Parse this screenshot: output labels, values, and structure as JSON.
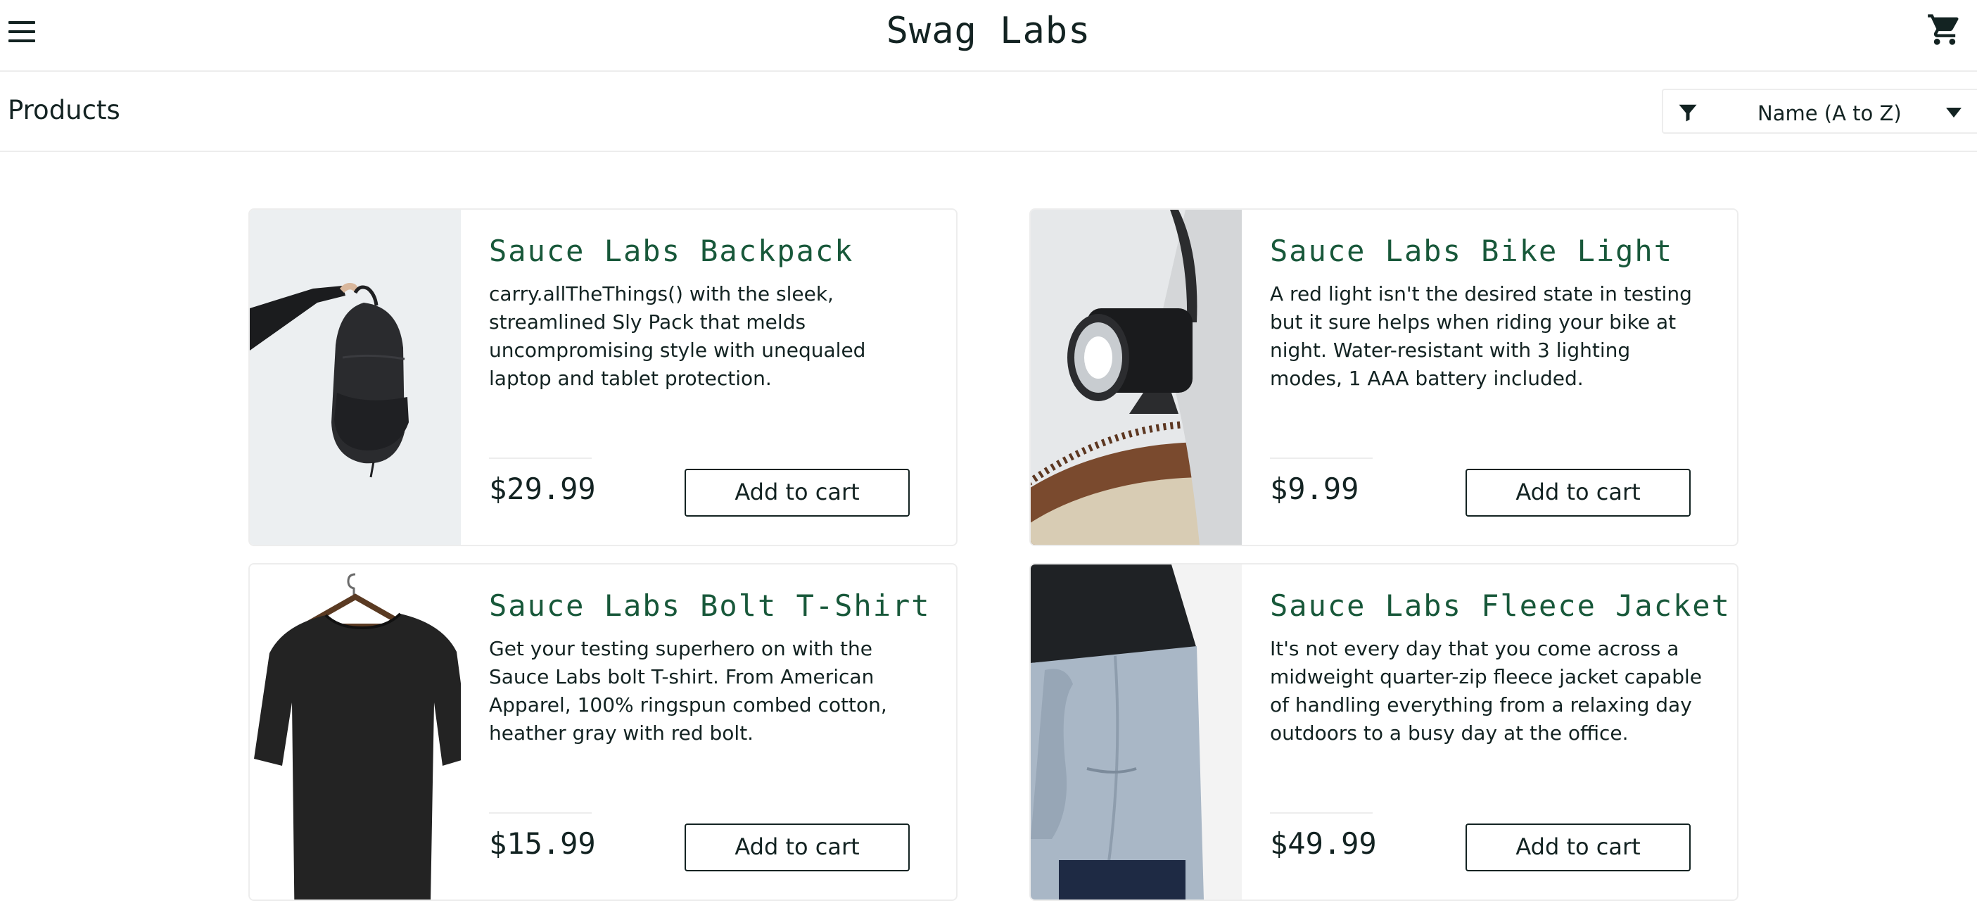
{
  "header": {
    "logo": "Swag Labs",
    "menu_icon": "hamburger-menu-icon",
    "cart_icon": "shopping-cart-icon"
  },
  "subheader": {
    "title": "Products",
    "sort_selected": "Name (A to Z)",
    "sort_icon": "filter-icon",
    "dropdown_icon": "caret-down-icon"
  },
  "colors": {
    "text": "#132322",
    "product_name": "#18583a",
    "border": "#ededed",
    "background": "#ffffff"
  },
  "products": [
    {
      "name": "Sauce Labs Backpack",
      "description": "carry.allTheThings() with the sleek, streamlined Sly Pack that melds uncompromising style with unequaled laptop and tablet protection.",
      "price": "$29.99",
      "button": "Add to cart",
      "image": "backpack-image"
    },
    {
      "name": "Sauce Labs Bike Light",
      "description": "A red light isn't the desired state in testing but it sure helps when riding your bike at night. Water-resistant with 3 lighting modes, 1 AAA battery included.",
      "price": "$9.99",
      "button": "Add to cart",
      "image": "bike-light-image"
    },
    {
      "name": "Sauce Labs Bolt T-Shirt",
      "description": "Get your testing superhero on with the Sauce Labs bolt T-shirt. From American Apparel, 100% ringspun combed cotton, heather gray with red bolt.",
      "price": "$15.99",
      "button": "Add to cart",
      "image": "t-shirt-image"
    },
    {
      "name": "Sauce Labs Fleece Jacket",
      "description": "It's not every day that you come across a midweight quarter-zip fleece jacket capable of handling everything from a relaxing day outdoors to a busy day at the office.",
      "price": "$49.99",
      "button": "Add to cart",
      "image": "fleece-jacket-image"
    }
  ]
}
